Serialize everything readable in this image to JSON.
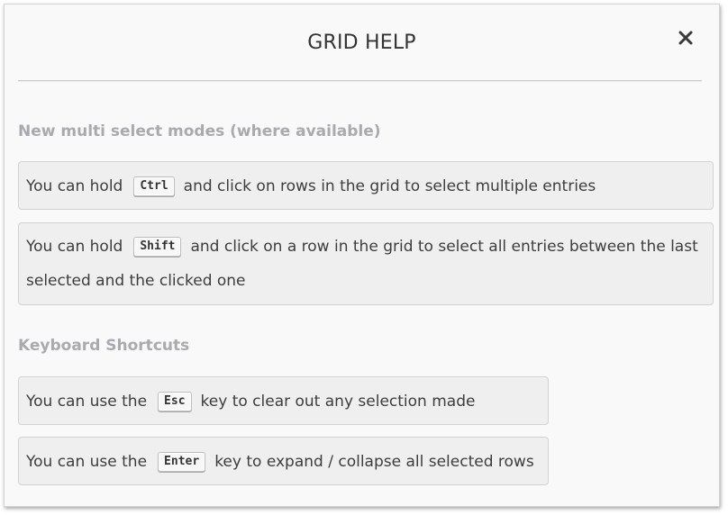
{
  "dialog": {
    "title": "GRID HELP",
    "close_icon": "close-icon"
  },
  "sections": {
    "multi_select": {
      "heading": "New multi select modes (where available)",
      "ctrl": {
        "before": "You can hold",
        "key": "Ctrl",
        "after": "and click on rows in the grid to select multiple entries"
      },
      "shift": {
        "before": "You can hold",
        "key": "Shift",
        "after": "and click on a row in the grid to select all entries between the last",
        "line2": "selected and the clicked one"
      }
    },
    "shortcuts": {
      "heading": "Keyboard Shortcuts",
      "esc": {
        "before": "You can use the",
        "key": "Esc",
        "after": "key to clear out any selection made"
      },
      "enter": {
        "before": "You can use the",
        "key": "Enter",
        "after": "key to expand / collapse all selected rows"
      }
    }
  }
}
